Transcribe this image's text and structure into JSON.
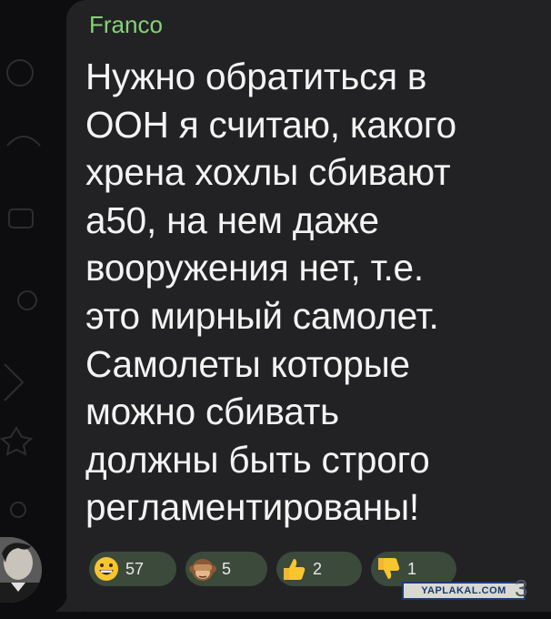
{
  "message": {
    "sender": "Franco",
    "lines": [
      "Нужно обратиться в",
      "ООН я считаю, какого",
      "хрена хохлы сбивают",
      "а50, на нем даже",
      "вооружения нет, т.е.",
      "это мирный самолет.",
      "Самолеты которые",
      "можно сбивать",
      "должны быть строго",
      "регламентированы!"
    ],
    "reactions": [
      {
        "emoji": "grinning-face-icon",
        "count": "57"
      },
      {
        "emoji": "see-no-evil-monkey-icon",
        "count": "5"
      },
      {
        "emoji": "thumbs-up-icon",
        "count": "2"
      },
      {
        "emoji": "thumbs-down-icon",
        "count": "1"
      }
    ]
  },
  "watermark": {
    "label": "YAPLAKAL.COM",
    "suffix": "3"
  },
  "colors": {
    "background": "#0d0d0f",
    "bubble": "#222225",
    "sender": "#86d277",
    "text": "#f3f3f3",
    "reaction_pill": "#3c4a3b"
  }
}
